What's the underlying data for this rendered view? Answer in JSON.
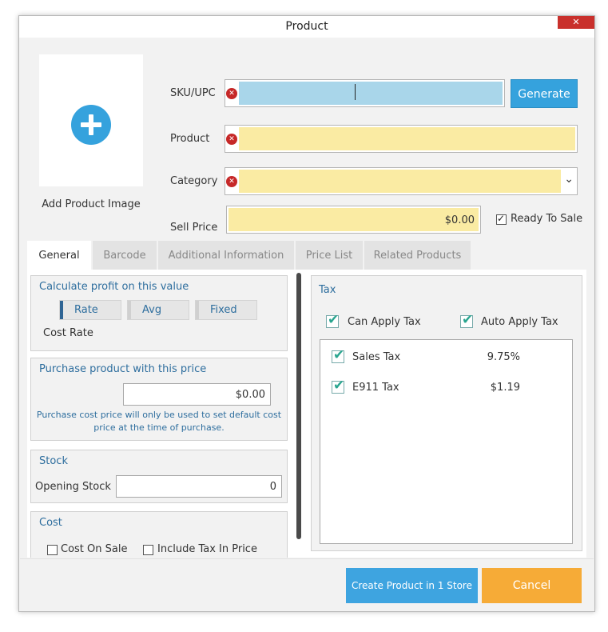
{
  "window": {
    "title": "Product",
    "close_glyph": "✕"
  },
  "image": {
    "label": "Add Product Image"
  },
  "form": {
    "sku_label": "SKU/UPC",
    "sku_value": "",
    "generate_label": "Generate",
    "product_label": "Product",
    "product_value": "",
    "category_label": "Category",
    "category_value": "",
    "sell_price_label": "Sell Price",
    "sell_price_value": "$0.00",
    "ready_to_sale_label": "Ready To Sale",
    "ready_to_sale_checked": true,
    "error_glyph": "✕",
    "dropdown_glyph": "⌄"
  },
  "tabs": [
    {
      "label": "General",
      "active": true
    },
    {
      "label": "Barcode",
      "active": false
    },
    {
      "label": "Additional Information",
      "active": false
    },
    {
      "label": "Price List",
      "active": false
    },
    {
      "label": "Related Products",
      "active": false
    }
  ],
  "general": {
    "profit": {
      "title": "Calculate profit on this value",
      "options": [
        "Rate",
        "Avg",
        "Fixed"
      ],
      "selected": "Rate",
      "selected_text": "Cost Rate"
    },
    "purchase": {
      "title": "Purchase product with this price",
      "value": "$0.00",
      "note_line1": "Purchase cost price will only be used to set default cost",
      "note_line2": "price at the time of purchase."
    },
    "stock": {
      "title": "Stock",
      "opening_label": "Opening Stock",
      "opening_value": "0"
    },
    "cost": {
      "title": "Cost",
      "cost_on_sale_label": "Cost On Sale",
      "cost_on_sale_checked": false,
      "include_tax_label": "Include Tax In Price",
      "include_tax_checked": false
    }
  },
  "tax": {
    "title": "Tax",
    "can_apply_label": "Can Apply Tax",
    "auto_apply_label": "Auto Apply Tax",
    "items": [
      {
        "name": "Sales Tax",
        "rate": "9.75%",
        "checked": true
      },
      {
        "name": "E911 Tax",
        "rate": "$1.19",
        "checked": true
      }
    ]
  },
  "footer": {
    "create_label": "Create Product in 1 Store",
    "cancel_label": "Cancel"
  },
  "colors": {
    "accent_blue": "#35a2dd",
    "required_yellow": "#faeba3",
    "focus_blue": "#a9d6ea",
    "cancel_orange": "#f6ab37",
    "check_teal": "#2aa58f",
    "error_red": "#c62828"
  }
}
